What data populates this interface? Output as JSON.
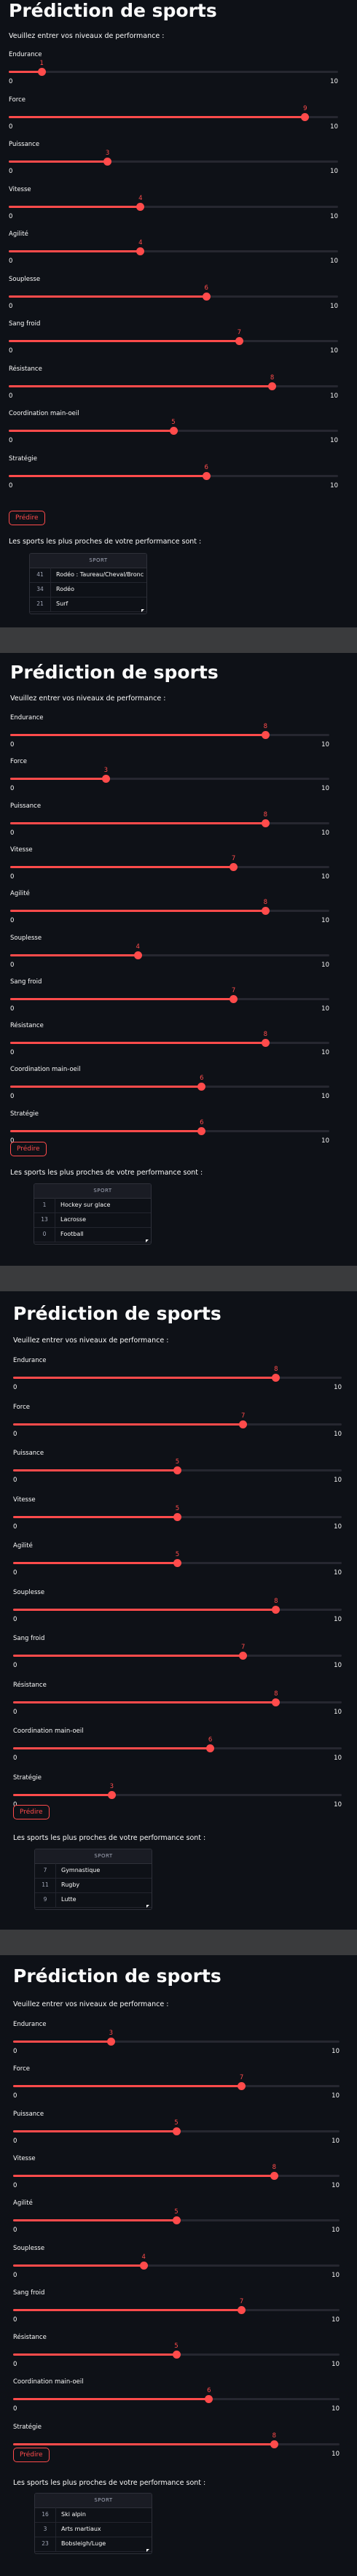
{
  "accent_color": "#ff4b4b",
  "background_color": "#0e1117",
  "separator_color": "#3a3b3d",
  "panels": [
    {
      "title": "Prédiction de sports",
      "subtitle": "Veuillez entrer vos niveaux de performance :",
      "sliders": [
        {
          "label": "Endurance",
          "value": 1,
          "min": 0,
          "max": 10
        },
        {
          "label": "Force",
          "value": 9,
          "min": 0,
          "max": 10
        },
        {
          "label": "Puissance",
          "value": 3,
          "min": 0,
          "max": 10
        },
        {
          "label": "Vitesse",
          "value": 4,
          "min": 0,
          "max": 10
        },
        {
          "label": "Agilité",
          "value": 4,
          "min": 0,
          "max": 10
        },
        {
          "label": "Souplesse",
          "value": 6,
          "min": 0,
          "max": 10
        },
        {
          "label": "Sang froid",
          "value": 7,
          "min": 0,
          "max": 10
        },
        {
          "label": "Résistance",
          "value": 8,
          "min": 0,
          "max": 10
        },
        {
          "label": "Coordination main-oeil",
          "value": 5,
          "min": 0,
          "max": 10
        },
        {
          "label": "Stratégie",
          "value": 6,
          "min": 0,
          "max": 10
        }
      ],
      "button_label": "Prédire",
      "result_text": "Les sports les plus proches de votre performance sont :",
      "table": {
        "header": "SPORT",
        "rows": [
          {
            "index": "41",
            "sport": "Rodéo : Taureau/Cheval/Bronco"
          },
          {
            "index": "34",
            "sport": "Rodéo"
          },
          {
            "index": "21",
            "sport": "Surf"
          }
        ]
      }
    },
    {
      "title": "Prédiction de sports",
      "subtitle": "Veuillez entrer vos niveaux de performance :",
      "sliders": [
        {
          "label": "Endurance",
          "value": 8,
          "min": 0,
          "max": 10
        },
        {
          "label": "Force",
          "value": 3,
          "min": 0,
          "max": 10
        },
        {
          "label": "Puissance",
          "value": 8,
          "min": 0,
          "max": 10
        },
        {
          "label": "Vitesse",
          "value": 7,
          "min": 0,
          "max": 10
        },
        {
          "label": "Agilité",
          "value": 8,
          "min": 0,
          "max": 10
        },
        {
          "label": "Souplesse",
          "value": 4,
          "min": 0,
          "max": 10
        },
        {
          "label": "Sang froid",
          "value": 7,
          "min": 0,
          "max": 10
        },
        {
          "label": "Résistance",
          "value": 8,
          "min": 0,
          "max": 10
        },
        {
          "label": "Coordination main-oeil",
          "value": 6,
          "min": 0,
          "max": 10
        },
        {
          "label": "Stratégie",
          "value": 6,
          "min": 0,
          "max": 10
        }
      ],
      "button_label": "Prédire",
      "result_text": "Les sports les plus proches de votre performance sont :",
      "table": {
        "header": "SPORT",
        "rows": [
          {
            "index": "1",
            "sport": "Hockey sur glace"
          },
          {
            "index": "13",
            "sport": "Lacrosse"
          },
          {
            "index": "0",
            "sport": "Football"
          }
        ]
      }
    },
    {
      "title": "Prédiction de sports",
      "subtitle": "Veuillez entrer vos niveaux de performance :",
      "sliders": [
        {
          "label": "Endurance",
          "value": 8,
          "min": 0,
          "max": 10
        },
        {
          "label": "Force",
          "value": 7,
          "min": 0,
          "max": 10
        },
        {
          "label": "Puissance",
          "value": 5,
          "min": 0,
          "max": 10
        },
        {
          "label": "Vitesse",
          "value": 5,
          "min": 0,
          "max": 10
        },
        {
          "label": "Agilité",
          "value": 5,
          "min": 0,
          "max": 10
        },
        {
          "label": "Souplesse",
          "value": 8,
          "min": 0,
          "max": 10
        },
        {
          "label": "Sang froid",
          "value": 7,
          "min": 0,
          "max": 10
        },
        {
          "label": "Résistance",
          "value": 8,
          "min": 0,
          "max": 10
        },
        {
          "label": "Coordination main-oeil",
          "value": 6,
          "min": 0,
          "max": 10
        },
        {
          "label": "Stratégie",
          "value": 3,
          "min": 0,
          "max": 10
        }
      ],
      "button_label": "Prédire",
      "result_text": "Les sports les plus proches de votre performance sont :",
      "table": {
        "header": "SPORT",
        "rows": [
          {
            "index": "7",
            "sport": "Gymnastique"
          },
          {
            "index": "11",
            "sport": "Rugby"
          },
          {
            "index": "9",
            "sport": "Lutte"
          }
        ]
      }
    },
    {
      "title": "Prédiction de sports",
      "subtitle": "Veuillez entrer vos niveaux de performance :",
      "sliders": [
        {
          "label": "Endurance",
          "value": 3,
          "min": 0,
          "max": 10
        },
        {
          "label": "Force",
          "value": 7,
          "min": 0,
          "max": 10
        },
        {
          "label": "Puissance",
          "value": 5,
          "min": 0,
          "max": 10
        },
        {
          "label": "Vitesse",
          "value": 8,
          "min": 0,
          "max": 10
        },
        {
          "label": "Agilité",
          "value": 5,
          "min": 0,
          "max": 10
        },
        {
          "label": "Souplesse",
          "value": 4,
          "min": 0,
          "max": 10
        },
        {
          "label": "Sang froid",
          "value": 7,
          "min": 0,
          "max": 10
        },
        {
          "label": "Résistance",
          "value": 5,
          "min": 0,
          "max": 10
        },
        {
          "label": "Coordination main-oeil",
          "value": 6,
          "min": 0,
          "max": 10
        },
        {
          "label": "Stratégie",
          "value": 8,
          "min": 0,
          "max": 10
        }
      ],
      "button_label": "Prédire",
      "result_text": "Les sports les plus proches de votre performance sont :",
      "table": {
        "header": "SPORT",
        "rows": [
          {
            "index": "16",
            "sport": "Ski alpin"
          },
          {
            "index": "3",
            "sport": "Arts martiaux"
          },
          {
            "index": "23",
            "sport": "Bobsleigh/Luge"
          }
        ]
      }
    }
  ]
}
